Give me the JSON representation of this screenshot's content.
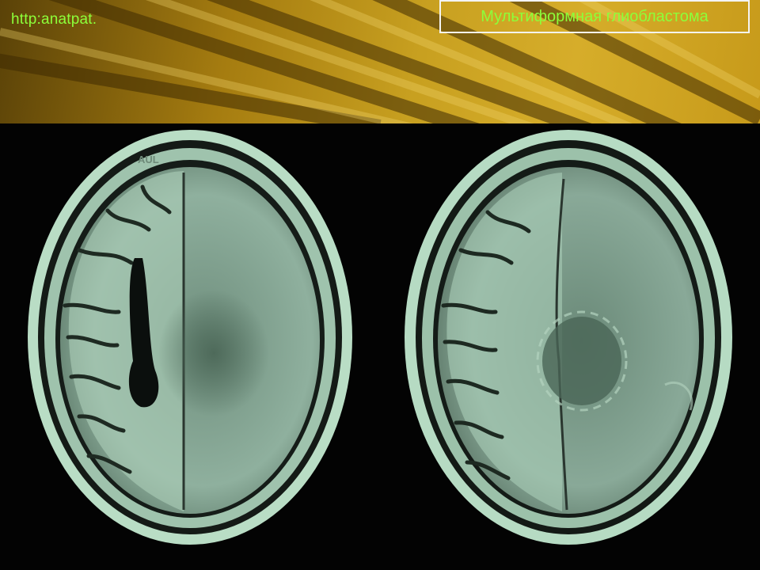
{
  "header": {
    "site_url": "http:anatpat.",
    "title": "Мультиформная глиобластома"
  },
  "scans": {
    "left_label": "AUL",
    "count": 2
  },
  "colors": {
    "accent_text": "#8cff3a",
    "header_gold": "#c8a020",
    "mri_tint": "#b7dcc2",
    "background": "#000000"
  }
}
